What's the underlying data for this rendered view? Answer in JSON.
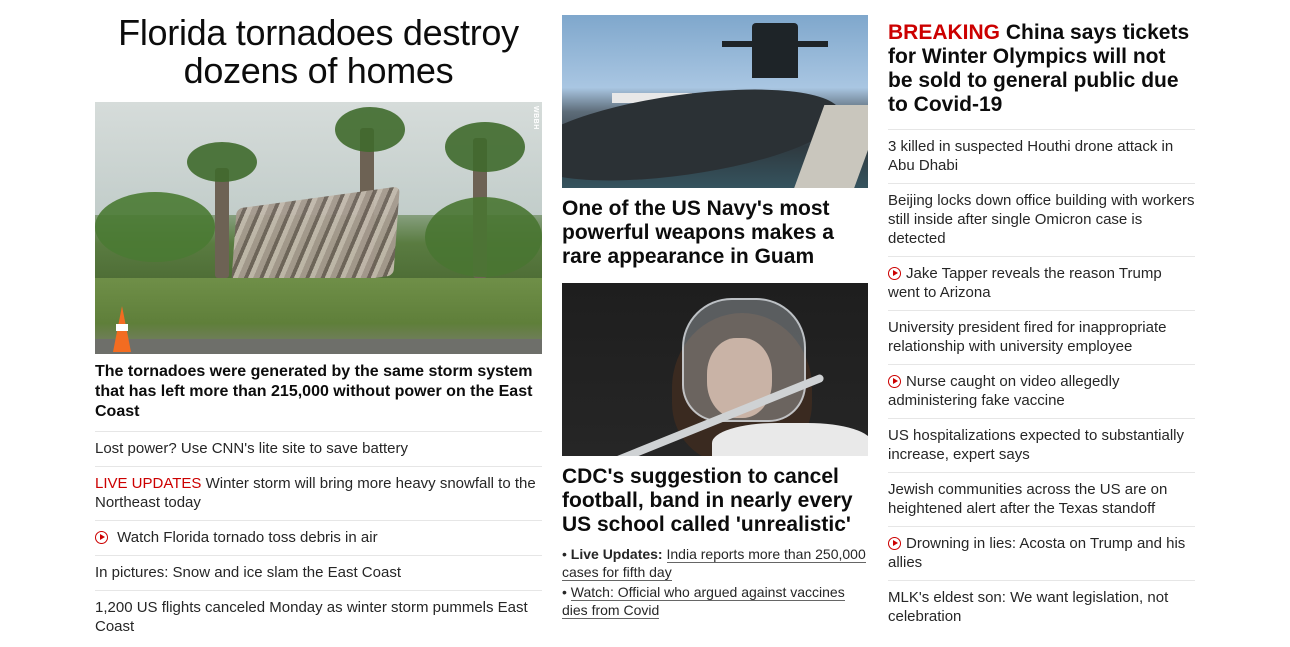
{
  "left": {
    "headline": "Florida tornadoes destroy dozens of homes",
    "image_watermark": "WBBH",
    "subheadline": "The tornadoes were generated by the same storm system that has left more than 215,000 without power on the East Coast",
    "links": [
      {
        "text": "Lost power? Use CNN's lite site to save battery"
      },
      {
        "prefix": "LIVE UPDATES",
        "text": "Winter storm will bring more heavy snowfall to the Northeast today"
      },
      {
        "text": "Watch Florida tornado toss debris in air",
        "icon": "play-icon"
      },
      {
        "text": "In pictures: Snow and ice slam the East Coast"
      },
      {
        "text": "1,200 US flights canceled Monday as winter storm pummels East Coast"
      }
    ]
  },
  "middle": {
    "story1_title": "One of the US Navy's most powerful weapons makes a rare appearance in Guam",
    "story2_title": "CDC's suggestion to cancel football, band in nearly every US school called 'unrealistic'",
    "bullets": [
      {
        "label": "Live Updates:",
        "text": "India reports more than 250,000 cases for fifth day"
      },
      {
        "text": "Watch: Official who argued against vaccines dies from Covid"
      }
    ]
  },
  "right": {
    "breaking_tag": "BREAKING",
    "breaking_text": "China says tickets for Winter Olympics will not be sold to general public due to Covid-19",
    "links": [
      {
        "text": "3 killed in suspected Houthi drone attack in Abu Dhabi"
      },
      {
        "text": "Beijing locks down office building with workers still inside after single Omicron case is detected"
      },
      {
        "text": "Jake Tapper reveals the reason Trump went to Arizona",
        "icon": "play-icon"
      },
      {
        "text": "University president fired for inappropriate relationship with university employee"
      },
      {
        "text": "Nurse caught on video allegedly administering fake vaccine",
        "icon": "play-icon"
      },
      {
        "text": "US hospitalizations expected to substantially increase, expert says"
      },
      {
        "text": "Jewish communities across the US are on heightened alert after the Texas standoff"
      },
      {
        "text": "Drowning in lies: Acosta on Trump and his allies",
        "icon": "play-icon"
      },
      {
        "text": "MLK's eldest son: We want legislation, not celebration"
      }
    ]
  },
  "colors": {
    "accent_red": "#cc0000",
    "text": "#0c0c0c",
    "divider": "#e6e6e6"
  }
}
